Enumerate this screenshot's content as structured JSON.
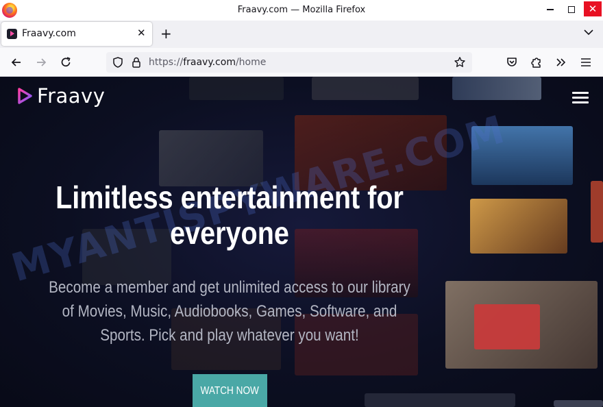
{
  "window": {
    "title": "Fraavy.com — Mozilla Firefox",
    "app_icon": "firefox-icon",
    "controls": {
      "minimize": "minimize-icon",
      "maximize": "maximize-icon",
      "close": "✕"
    }
  },
  "tabs": [
    {
      "title": "Fraavy.com",
      "favicon": "fraavy-play-icon",
      "close": "✕",
      "active": true
    }
  ],
  "tabstrip": {
    "new_tab": "+",
    "list_all": "chevron-down-icon"
  },
  "navbar": {
    "url_scheme": "https://",
    "url_host": "fraavy.com",
    "url_path": "/home",
    "icons": [
      "back-icon",
      "forward-icon",
      "reload-icon",
      "shield-icon",
      "lock-icon",
      "bookmark-star-icon",
      "pocket-icon",
      "extensions-icon",
      "overflow-icon",
      "app-menu-icon"
    ]
  },
  "site": {
    "brand": "Fraavy",
    "brand_colors": {
      "gradient_start": "#ff3fa4",
      "gradient_end": "#7a5cff"
    },
    "headline_line1": "Limitless entertainment for",
    "headline_line2": "everyone",
    "subheadline": "Become a member and get unlimited access to our library of Movies, Music, Audiobooks, Games, Software, and Sports. Pick and play whatever you want!",
    "cta_label": "WATCH NOW",
    "cta_color": "#4aa8a6",
    "watermark": "MYANTISPYWARE.COM"
  }
}
